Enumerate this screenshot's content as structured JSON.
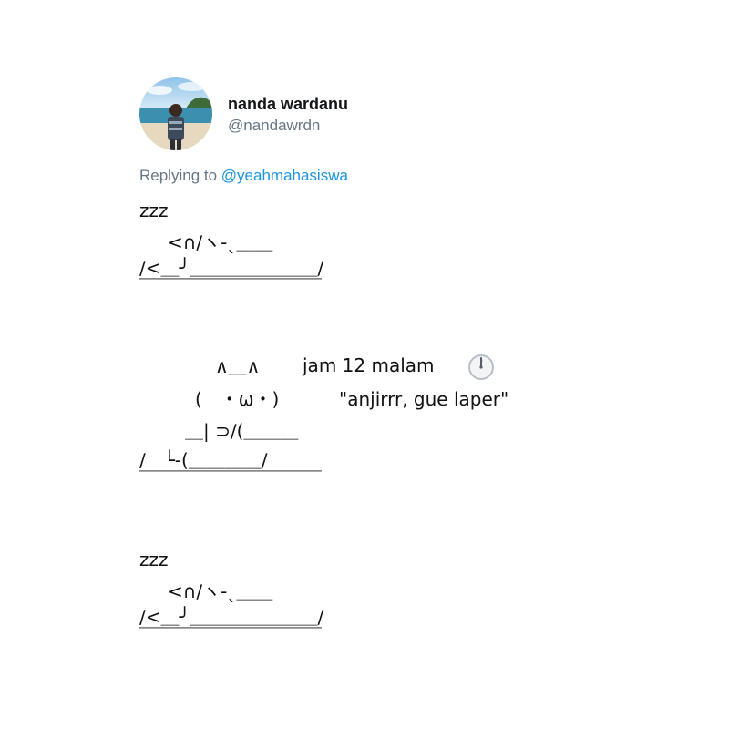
{
  "tweet": {
    "display_name": "nanda wardanu",
    "handle": "@nandawrdn",
    "replying_prefix": "Replying to ",
    "replying_to": "@yeahmahasiswa",
    "avatar_icon": "profile-photo-avatar"
  },
  "scene1": {
    "zzz": "zzz",
    "line1": "<∩∕ヽ‐ˎ＿＿",
    "line2": "∕<＿╯＿＿＿＿＿＿＿∕",
    "line3": "￣￣￣￣￣￣￣￣￣￣"
  },
  "scene2": {
    "ears": "∧＿∧",
    "caption1": "jam 12 malam",
    "clock_icon": "clock-icon",
    "face": "(　・ω・)",
    "caption2": "\"anjirrr, gue laper\"",
    "body1": "＿| ⊃∕(＿＿＿",
    "body2": "∕　└-(＿＿＿＿∕",
    "floor": "￣￣￣￣￣￣￣￣￣￣"
  },
  "scene3": {
    "zzz": "zzz",
    "line1": "<∩∕ヽ‐ˎ＿＿",
    "line2": "∕<＿╯＿＿＿＿＿＿＿∕",
    "line3": "￣￣￣￣￣￣￣￣￣￣"
  },
  "colors": {
    "name": "#14171a",
    "secondary": "#657786",
    "link": "#1b95e0",
    "text": "#111111"
  }
}
